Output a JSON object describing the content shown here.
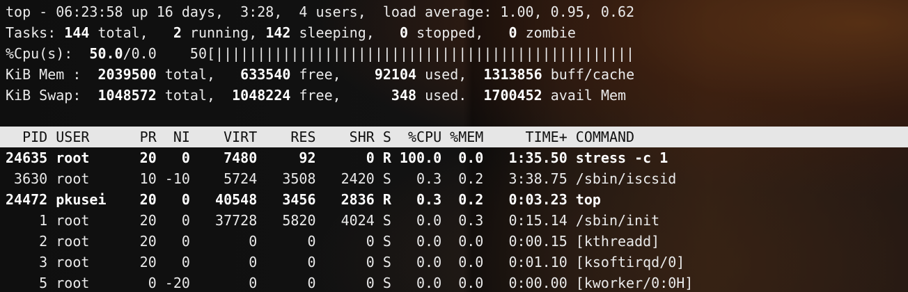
{
  "summary": {
    "line1": "top - 06:23:58 up 16 days,  3:28,  4 users,  load average: 1.00, 0.95, 0.62",
    "tasks": {
      "label": "Tasks: ",
      "total": "144",
      "total_sfx": " total,   ",
      "running": "2",
      "running_sfx": " running, ",
      "sleeping": "142",
      "sleeping_sfx": " sleeping,   ",
      "stopped": "0",
      "stopped_sfx": " stopped,   ",
      "zombie": "0",
      "zombie_sfx": " zombie"
    },
    "cpu": {
      "label": "%Cpu(s):  ",
      "value": "50.0",
      "rest": "/0.0    50[",
      "bar": "||||||||||||||||||||||||||||||||||||||||||||||||||"
    },
    "mem": {
      "label": "KiB Mem :  ",
      "total": "2039500",
      "total_sfx": " total,   ",
      "free": "633540",
      "free_sfx": " free,    ",
      "used": "92104",
      "used_sfx": " used,  ",
      "cache": "1313856",
      "cache_sfx": " buff/cache"
    },
    "swap": {
      "label": "KiB Swap:  ",
      "total": "1048572",
      "total_sfx": " total,  ",
      "free": "1048224",
      "free_sfx": " free,      ",
      "used": "348",
      "used_sfx": " used.  ",
      "avail": "1700452",
      "avail_sfx": " avail Mem"
    }
  },
  "table": {
    "header": "  PID USER      PR  NI    VIRT    RES    SHR S  %CPU %MEM     TIME+ COMMAND",
    "rows": [
      "24635 root      20   0    7480     92      0 R 100.0  0.0   1:35.50 stress -c 1",
      " 3630 root      10 -10    5724   3508   2420 S   0.3  0.2   3:38.75 /sbin/iscsid",
      "24472 pkusei    20   0   40548   3456   2836 R   0.3  0.2   0:03.23 top",
      "    1 root      20   0   37728   5820   4024 S   0.0  0.3   0:15.14 /sbin/init",
      "    2 root      20   0       0      0      0 S   0.0  0.0   0:00.15 [kthreadd]",
      "    3 root      20   0       0      0      0 S   0.0  0.0   0:01.10 [ksoftirqd/0]",
      "    5 root       0 -20       0      0      0 S   0.0  0.0   0:00.00 [kworker/0:0H]"
    ]
  },
  "colors": {
    "text": "#eaeaea",
    "header_bg": "#e6e6e6",
    "header_text": "#111111"
  }
}
